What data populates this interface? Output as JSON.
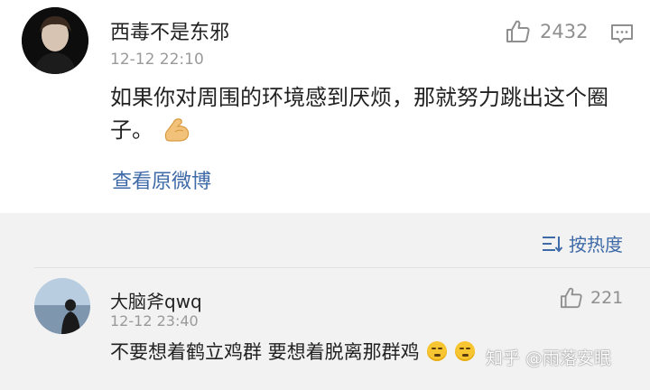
{
  "main_comment": {
    "username": "西毒不是东邪",
    "time": "12-12 22:10",
    "likes": "2432",
    "text": "如果你对周围的环境感到厌烦，那就努力跳出这个圈子。",
    "emoji_icon": "flexed-biceps",
    "view_original_label": "查看原微博"
  },
  "sort": {
    "label": "按热度"
  },
  "second_comment": {
    "username": "大脑斧qwq",
    "time": "12-12 23:40",
    "likes": "221",
    "text": "不要想着鹤立鸡群 要想着脱离那群鸡",
    "emoji_icon": "thinking-face"
  },
  "watermark": "知乎 @雨落安眠",
  "colors": {
    "link": "#3e6aa8",
    "band_background": "#f2f2f2",
    "meta_gray": "#9a9a9a"
  }
}
